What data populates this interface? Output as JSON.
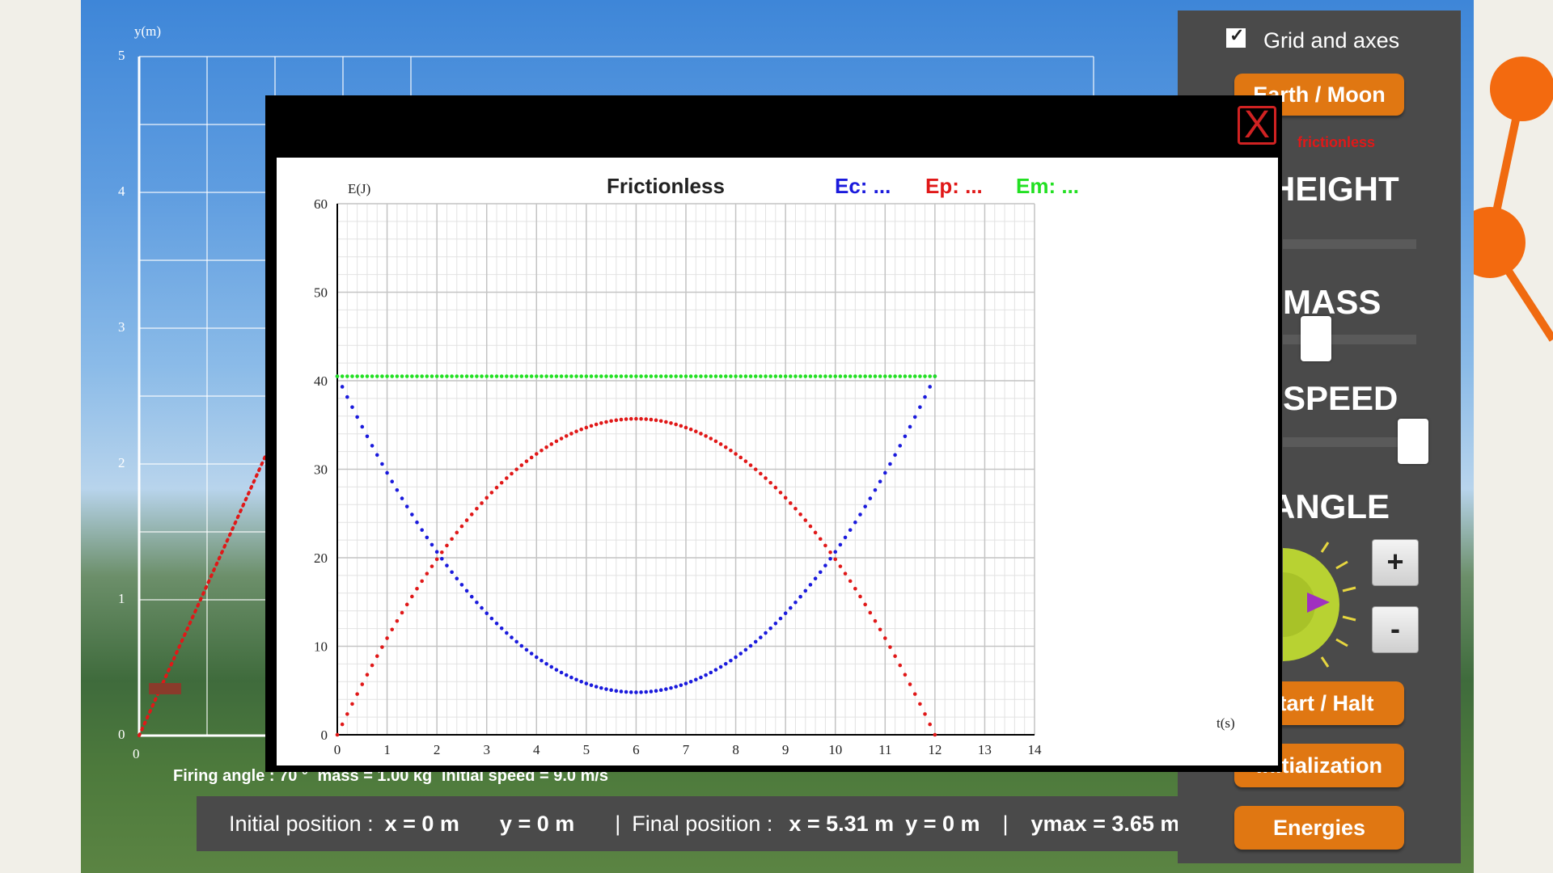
{
  "scene": {
    "y_axis_label": "y(m)",
    "y_ticks": [
      "0",
      "1",
      "2",
      "3",
      "4",
      "5"
    ],
    "x_tick_zero": "0",
    "status": {
      "angle": "Firing angle : 70 °",
      "mass": "mass = 1.00 kg",
      "speed": "initial speed = 9.0 m/s"
    },
    "info": {
      "initial_label": "Initial position :",
      "initial_x": "x = 0 m",
      "initial_y": "y = 0 m",
      "sep1": "|",
      "final_label": "Final position :",
      "final_x": "x = 5.31 m",
      "final_y": "y = 0 m",
      "sep2": "|",
      "ymax": "ymax = 3.65 m"
    }
  },
  "panel": {
    "grid_label": "Grid and axes",
    "grid_checked": true,
    "planet_button": "Earth / Moon",
    "mode_text": "frictionless",
    "height_heading": "HEIGHT",
    "mass_heading": "MASS",
    "speed_heading": "SPEED",
    "angle_heading": "ANGLE",
    "plus": "+",
    "minus": "-",
    "start_button": "Start / Halt",
    "init_button": "Initialization",
    "energies_button": "Energies"
  },
  "modal": {
    "close": "X"
  },
  "chart_data": {
    "type": "scatter",
    "title": "Frictionless",
    "xlabel": "t(s)",
    "ylabel": "E(J)",
    "xlim": [
      0,
      14
    ],
    "ylim": [
      0,
      60
    ],
    "x_ticks": [
      0,
      1,
      2,
      3,
      4,
      5,
      6,
      7,
      8,
      9,
      10,
      11,
      12,
      13,
      14
    ],
    "y_ticks": [
      0,
      10,
      20,
      30,
      40,
      50,
      60
    ],
    "grid": true,
    "legend": "top",
    "series": [
      {
        "name": "Ec: ...",
        "color": "#1a1adc",
        "model": "40.5 - 35.7*(1-((t-6)/6)^2)",
        "t_range": [
          0,
          12
        ]
      },
      {
        "name": "Ep: ...",
        "color": "#e01818",
        "model": "35.7*(1-((t-6)/6)^2)",
        "t_range": [
          0,
          12
        ]
      },
      {
        "name": "Em: ...",
        "color": "#22e022",
        "model": "40.5 constant",
        "t_range": [
          0,
          12
        ]
      }
    ],
    "key_points": {
      "Ec": [
        [
          0,
          40.5
        ],
        [
          2,
          20.7
        ],
        [
          6,
          4.8
        ],
        [
          10,
          20.7
        ],
        [
          12,
          40.5
        ]
      ],
      "Ep": [
        [
          0,
          0
        ],
        [
          2,
          19.8
        ],
        [
          6,
          35.7
        ],
        [
          10,
          19.8
        ],
        [
          12,
          0
        ]
      ],
      "Em": [
        [
          0,
          40.5
        ],
        [
          12,
          40.5
        ]
      ]
    }
  }
}
